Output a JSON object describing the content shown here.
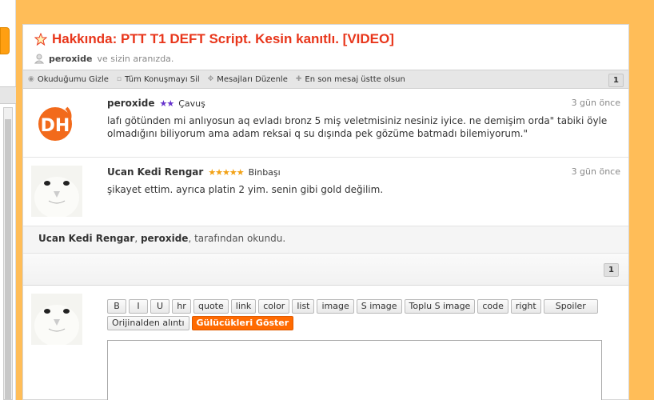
{
  "topic": {
    "title": "Hakkında: PTT T1 DEFT Script. Kesin kanıtlı. [VIDEO]",
    "participant_name": "peroxide",
    "participant_suffix": "ve sizin aranızda."
  },
  "toolbar": {
    "items": [
      {
        "label": "Okuduğumu Gizle",
        "icon": "eye-icon"
      },
      {
        "label": "Tüm Konuşmayı Sil",
        "icon": "trash-icon"
      },
      {
        "label": "Mesajları Düzenle",
        "icon": "move-icon"
      },
      {
        "label": "En son mesaj üstte olsun",
        "icon": "arrow-icon"
      }
    ],
    "page": "1"
  },
  "messages": [
    {
      "author": "peroxide",
      "rank_stars": "★★",
      "rank": "Çavuş",
      "time": "3 gün önce",
      "text": "lafı götünden mi anlıyosun aq evladı bronz 5 miş veletmisiniz nesiniz iyice. ne demişim orda\" tabiki öyle olmadığını biliyorum ama adam reksai q su dışında pek gözüme batmadı bilemiyorum.\""
    },
    {
      "author": "Ucan Kedi Rengar",
      "rank_stars": "★★★★★",
      "rank": "Binbaşı",
      "time": "3 gün önce",
      "text": "şikayet ettim. ayrıca platin 2 yim. senin gibi gold değilim."
    }
  ],
  "readby": {
    "user1": "Ucan Kedi Rengar",
    "sep": ", ",
    "user2": "peroxide",
    "suffix": ", tarafından okundu."
  },
  "pager": {
    "page": "1"
  },
  "editor": {
    "buttons": [
      "B",
      "I",
      "U",
      "hr",
      "quote",
      "link",
      "color",
      "list",
      "image",
      "S image",
      "Toplu S image",
      "code",
      "right",
      "Spoiler",
      "Orijinalden alıntı"
    ],
    "smiley_button": "Gülücükleri Göster"
  },
  "colors": {
    "title": "#e8361b",
    "accent": "#ff6a00",
    "background": "#ffbd58"
  }
}
